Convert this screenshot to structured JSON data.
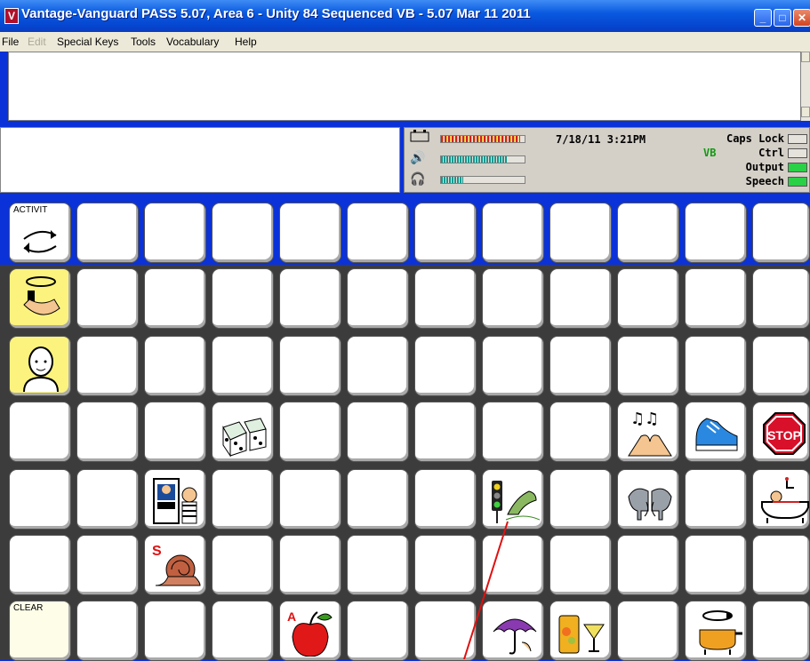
{
  "window": {
    "title": "Vantage-Vanguard PASS 5.07, Area 6 - Unity 84 Sequenced VB - 5.07 Mar 11 2011",
    "icon_glyph": "V"
  },
  "menu": {
    "file": "File",
    "edit": "Edit",
    "special_keys": "Special Keys",
    "tools": "Tools",
    "vocabulary": "Vocabulary",
    "help": "Help"
  },
  "status": {
    "datetime": "7/18/11  3:21PM",
    "mode": "VB",
    "caps_lock": "Caps Lock",
    "ctrl": "Ctrl",
    "output": "Output",
    "speech": "Speech",
    "battery_level": 0.95,
    "volume_level": 0.8,
    "headphone_level": 0.27
  },
  "keys": {
    "activity": "ACTIVIT",
    "clear": "CLEAR",
    "stop": "STOP",
    "snail_letter": "S",
    "apple_letter": "A"
  },
  "icons": [
    "activity-cycle-icon",
    "hands-cycle-icon",
    "woman-icon",
    "dice-icon",
    "music-hands-icon",
    "sneaker-icon",
    "stop-sign-icon",
    "police-station-icon",
    "traffic-light-frog-icon",
    "elephants-icon",
    "bath-icon",
    "snail-icon",
    "apple-icon",
    "umbrella-icon",
    "drinks-icon",
    "cooking-pot-icon"
  ]
}
